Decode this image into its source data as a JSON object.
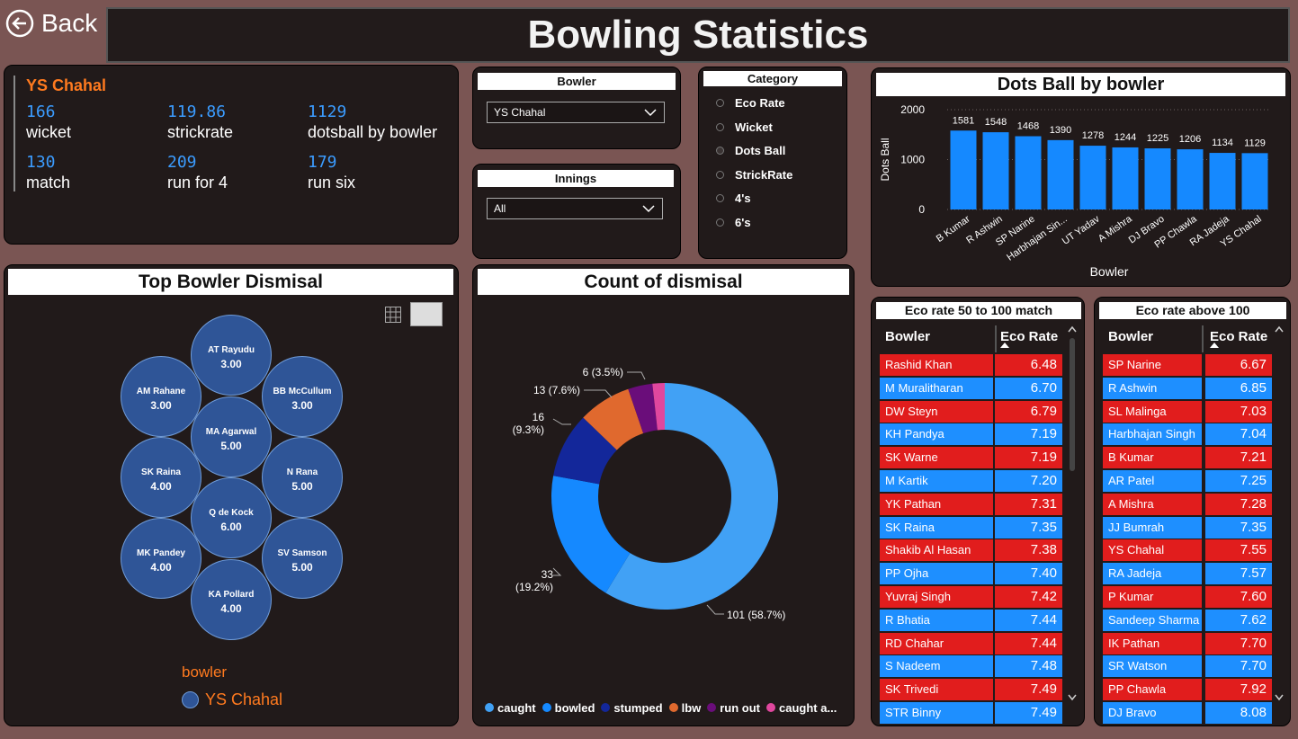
{
  "header": {
    "title": "Bowling Statistics",
    "back_label": "Back"
  },
  "kpi": {
    "bowler_name": "YS Chahal",
    "items": [
      {
        "value": "166",
        "label": "wicket"
      },
      {
        "value": "119.86",
        "label": "strickrate"
      },
      {
        "value": "1129",
        "label": "dotsball by bowler"
      },
      {
        "value": "130",
        "label": "match"
      },
      {
        "value": "209",
        "label": "run for 4"
      },
      {
        "value": "179",
        "label": "run six"
      }
    ]
  },
  "slicers": {
    "bowler": {
      "title": "Bowler",
      "value": "YS Chahal"
    },
    "innings": {
      "title": "Innings",
      "value": "All"
    },
    "category": {
      "title": "Category",
      "options": [
        "Eco Rate",
        "Wicket",
        "Dots Ball",
        "StrickRate",
        "4's",
        "6's"
      ],
      "selected": "Dots Ball"
    }
  },
  "dots_chart_title": "Dots Ball by bowler",
  "bubble_panel": {
    "title": "Top Bowler Dismisal",
    "legend_title": "bowler",
    "legend_item": "YS Chahal",
    "bubbles": [
      {
        "name": "AT Rayudu",
        "value": "3.00"
      },
      {
        "name": "AM Rahane",
        "value": "3.00"
      },
      {
        "name": "BB McCullum",
        "value": "3.00"
      },
      {
        "name": "MA Agarwal",
        "value": "5.00"
      },
      {
        "name": "SK Raina",
        "value": "4.00"
      },
      {
        "name": "N Rana",
        "value": "5.00"
      },
      {
        "name": "Q de Kock",
        "value": "6.00"
      },
      {
        "name": "MK Pandey",
        "value": "4.00"
      },
      {
        "name": "SV Samson",
        "value": "5.00"
      },
      {
        "name": "KA Pollard",
        "value": "4.00"
      }
    ]
  },
  "dismissal_title": "Count of dismisal",
  "donut_labels": {
    "caught": "101 (58.7%)",
    "bowled_a": "33",
    "bowled_b": "(19.2%)",
    "stumped_a": "16",
    "stumped_b": "(9.3%)",
    "lbw": "13 (7.6%)",
    "runout": "6 (3.5%)"
  },
  "donut_legend": [
    {
      "label": "caught",
      "color": "#41a1f5"
    },
    {
      "label": "bowled",
      "color": "#1589ff"
    },
    {
      "label": "stumped",
      "color": "#13279a"
    },
    {
      "label": "lbw",
      "color": "#e0692e"
    },
    {
      "label": "run out",
      "color": "#6a0d7a"
    },
    {
      "label": "caught a...",
      "color": "#e0479e"
    }
  ],
  "table1": {
    "title": "Eco rate 50 to 100 match",
    "col_bowler": "Bowler",
    "col_eco": "Eco Rate",
    "rows": [
      {
        "name": "Rashid Khan",
        "eco": "6.48"
      },
      {
        "name": "M Muralitharan",
        "eco": "6.70"
      },
      {
        "name": "DW Steyn",
        "eco": "6.79"
      },
      {
        "name": "KH Pandya",
        "eco": "7.19"
      },
      {
        "name": "SK Warne",
        "eco": "7.19"
      },
      {
        "name": "M Kartik",
        "eco": "7.20"
      },
      {
        "name": "YK Pathan",
        "eco": "7.31"
      },
      {
        "name": "SK Raina",
        "eco": "7.35"
      },
      {
        "name": "Shakib Al Hasan",
        "eco": "7.38"
      },
      {
        "name": "PP Ojha",
        "eco": "7.40"
      },
      {
        "name": "Yuvraj Singh",
        "eco": "7.42"
      },
      {
        "name": "R Bhatia",
        "eco": "7.44"
      },
      {
        "name": "RD Chahar",
        "eco": "7.44"
      },
      {
        "name": "S Nadeem",
        "eco": "7.48"
      },
      {
        "name": "SK Trivedi",
        "eco": "7.49"
      },
      {
        "name": "STR Binny",
        "eco": "7.49"
      }
    ]
  },
  "table2": {
    "title": "Eco rate above 100",
    "col_bowler": "Bowler",
    "col_eco": "Eco Rate",
    "rows": [
      {
        "name": "SP Narine",
        "eco": "6.67"
      },
      {
        "name": "R Ashwin",
        "eco": "6.85"
      },
      {
        "name": "SL Malinga",
        "eco": "7.03"
      },
      {
        "name": "Harbhajan Singh",
        "eco": "7.04"
      },
      {
        "name": "B Kumar",
        "eco": "7.21"
      },
      {
        "name": "AR Patel",
        "eco": "7.25"
      },
      {
        "name": "A Mishra",
        "eco": "7.28"
      },
      {
        "name": "JJ Bumrah",
        "eco": "7.35"
      },
      {
        "name": "YS Chahal",
        "eco": "7.55"
      },
      {
        "name": "RA Jadeja",
        "eco": "7.57"
      },
      {
        "name": "P Kumar",
        "eco": "7.60"
      },
      {
        "name": "Sandeep Sharma",
        "eco": "7.62"
      },
      {
        "name": "IK Pathan",
        "eco": "7.70"
      },
      {
        "name": "SR Watson",
        "eco": "7.70"
      },
      {
        "name": "PP Chawla",
        "eco": "7.92"
      },
      {
        "name": "DJ Bravo",
        "eco": "8.08"
      }
    ]
  },
  "colors": {
    "bar": "#1589ff",
    "accent_orange": "#ff7a1f",
    "kpi_blue": "#3b9cff",
    "row_red": "#e11d1d",
    "row_blue": "#1e8fff"
  },
  "chart_data": [
    {
      "type": "bar",
      "title": "Dots Ball by bowler",
      "xlabel": "Bowler",
      "ylabel": "Dots Ball",
      "categories": [
        "B Kumar",
        "R Ashwin",
        "SP Narine",
        "Harbhajan Sin...",
        "UT Yadav",
        "A Mishra",
        "DJ Bravo",
        "PP Chawla",
        "RA Jadeja",
        "YS Chahal"
      ],
      "values": [
        1581,
        1548,
        1468,
        1390,
        1278,
        1244,
        1225,
        1206,
        1134,
        1129
      ],
      "ylim": [
        0,
        2000
      ],
      "yticks": [
        0,
        1000,
        2000
      ],
      "grid": true
    },
    {
      "type": "pie",
      "title": "Count of dismisal",
      "categories": [
        "caught",
        "bowled",
        "stumped",
        "lbw",
        "run out",
        "caught and bowled"
      ],
      "values": [
        101,
        33,
        16,
        13,
        6,
        3
      ],
      "percent": [
        58.7,
        19.2,
        9.3,
        7.6,
        3.5,
        1.7
      ],
      "legend": "bottom"
    }
  ]
}
